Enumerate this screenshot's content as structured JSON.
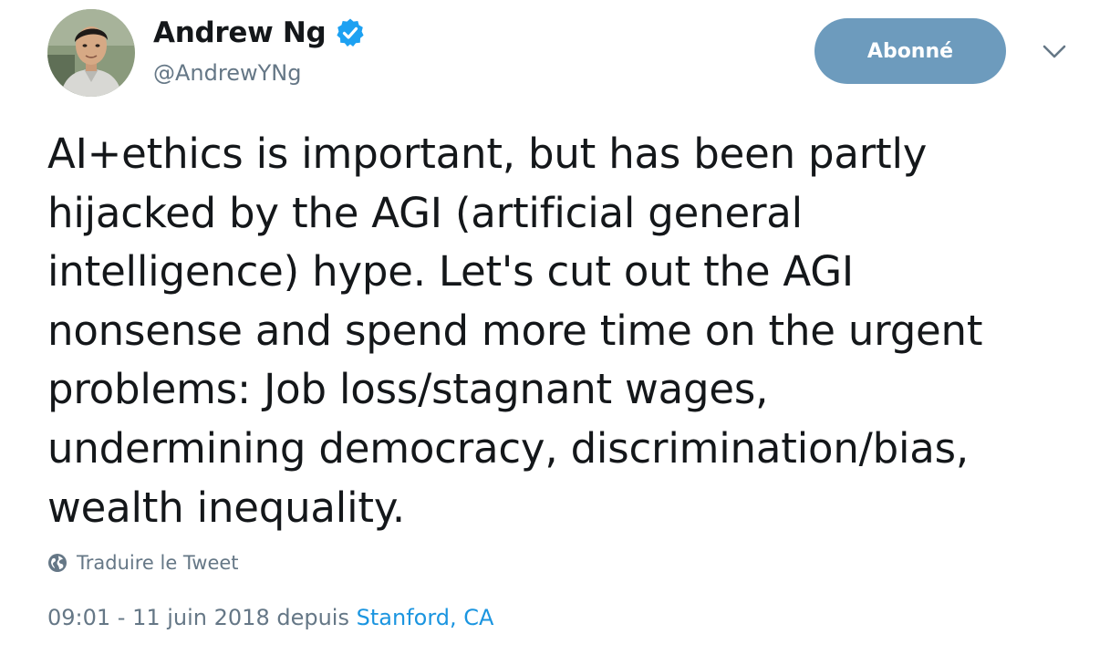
{
  "author": {
    "display_name": "Andrew Ng",
    "handle": "@AndrewYNg",
    "verified": true,
    "avatar_icon": "profile-photo"
  },
  "follow_button": {
    "label": "Abonné",
    "background_color": "#6d9bbd"
  },
  "more_menu_icon": "chevron-down-icon",
  "tweet": {
    "text_lines": [
      "AI+ethics is important, but has been partly",
      "hijacked by the AGI (artificial general",
      "intelligence) hype. Let's cut out the AGI",
      "nonsense and spend more time on the urgent",
      "problems: Job loss/stagnant wages,",
      "undermining democracy, discrimination/bias,",
      "wealth inequality."
    ]
  },
  "translate": {
    "icon": "globe-icon",
    "label": "Traduire le Tweet"
  },
  "meta": {
    "timestamp": "09:01 - 11 juin 2018",
    "from_word": "depuis",
    "location": "Stanford, CA"
  },
  "colors": {
    "text": "#14171a",
    "secondary": "#657786",
    "link": "#1b95e0",
    "verified_badge": "#1da1f2"
  }
}
